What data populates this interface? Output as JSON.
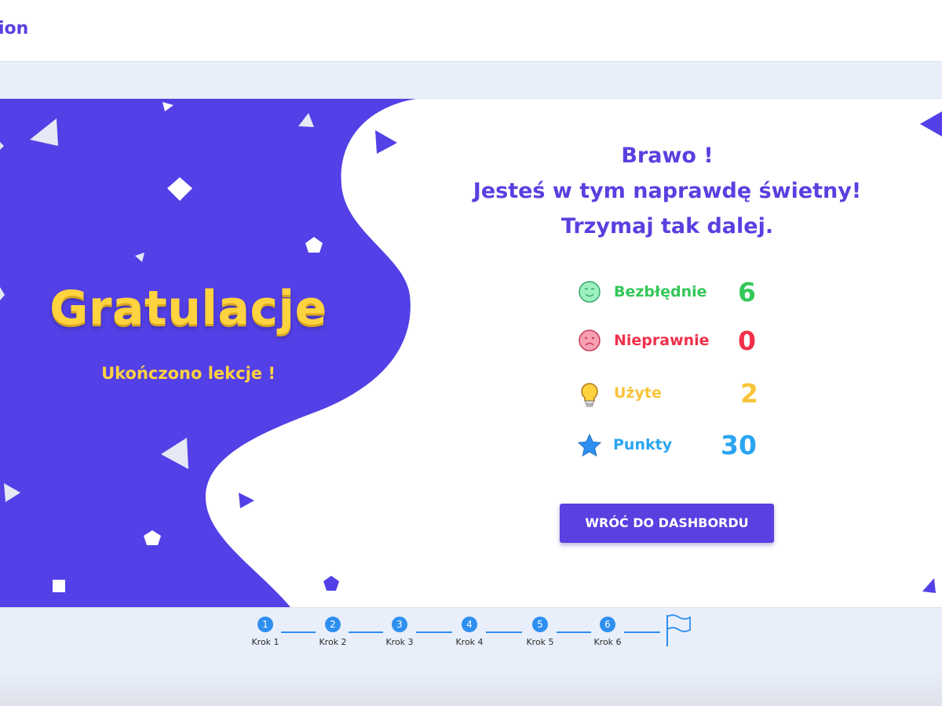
{
  "header": {
    "brand": "ion"
  },
  "hero": {
    "title": "Gratulacje",
    "subtitle": "Ukończono lekcje !"
  },
  "message": {
    "line1": "Brawo !",
    "line2": "Jesteś w tym naprawdę świetny!",
    "line3": "Trzymaj tak dalej."
  },
  "stats": [
    {
      "label": "Bezbłędnie",
      "value": "6",
      "color": "#34c759",
      "icon": "smile-face-icon"
    },
    {
      "label": "Nieprawnie",
      "value": "0",
      "color": "#f0304a",
      "icon": "sad-face-icon"
    },
    {
      "label": "Użyte",
      "value": "2",
      "color": "#f8c53a",
      "icon": "lightbulb-icon"
    },
    {
      "label": "Punkty",
      "value": "30",
      "color": "#2aa5f0",
      "icon": "star-icon"
    }
  ],
  "button": {
    "label": "WRÓĆ DO DASHBORDU"
  },
  "stepper": {
    "steps": [
      {
        "number": "1",
        "label": "Krok 1"
      },
      {
        "number": "2",
        "label": "Krok 2"
      },
      {
        "number": "3",
        "label": "Krok 3"
      },
      {
        "number": "4",
        "label": "Krok 4"
      },
      {
        "number": "5",
        "label": "Krok 5"
      },
      {
        "number": "6",
        "label": "Krok 6"
      }
    ],
    "finish_icon": "flag-icon"
  },
  "colors": {
    "accent": "#5b3fe0",
    "title_yellow": "#ffd23f",
    "step_blue": "#2e8ff0",
    "page_bg": "#e9effa"
  }
}
